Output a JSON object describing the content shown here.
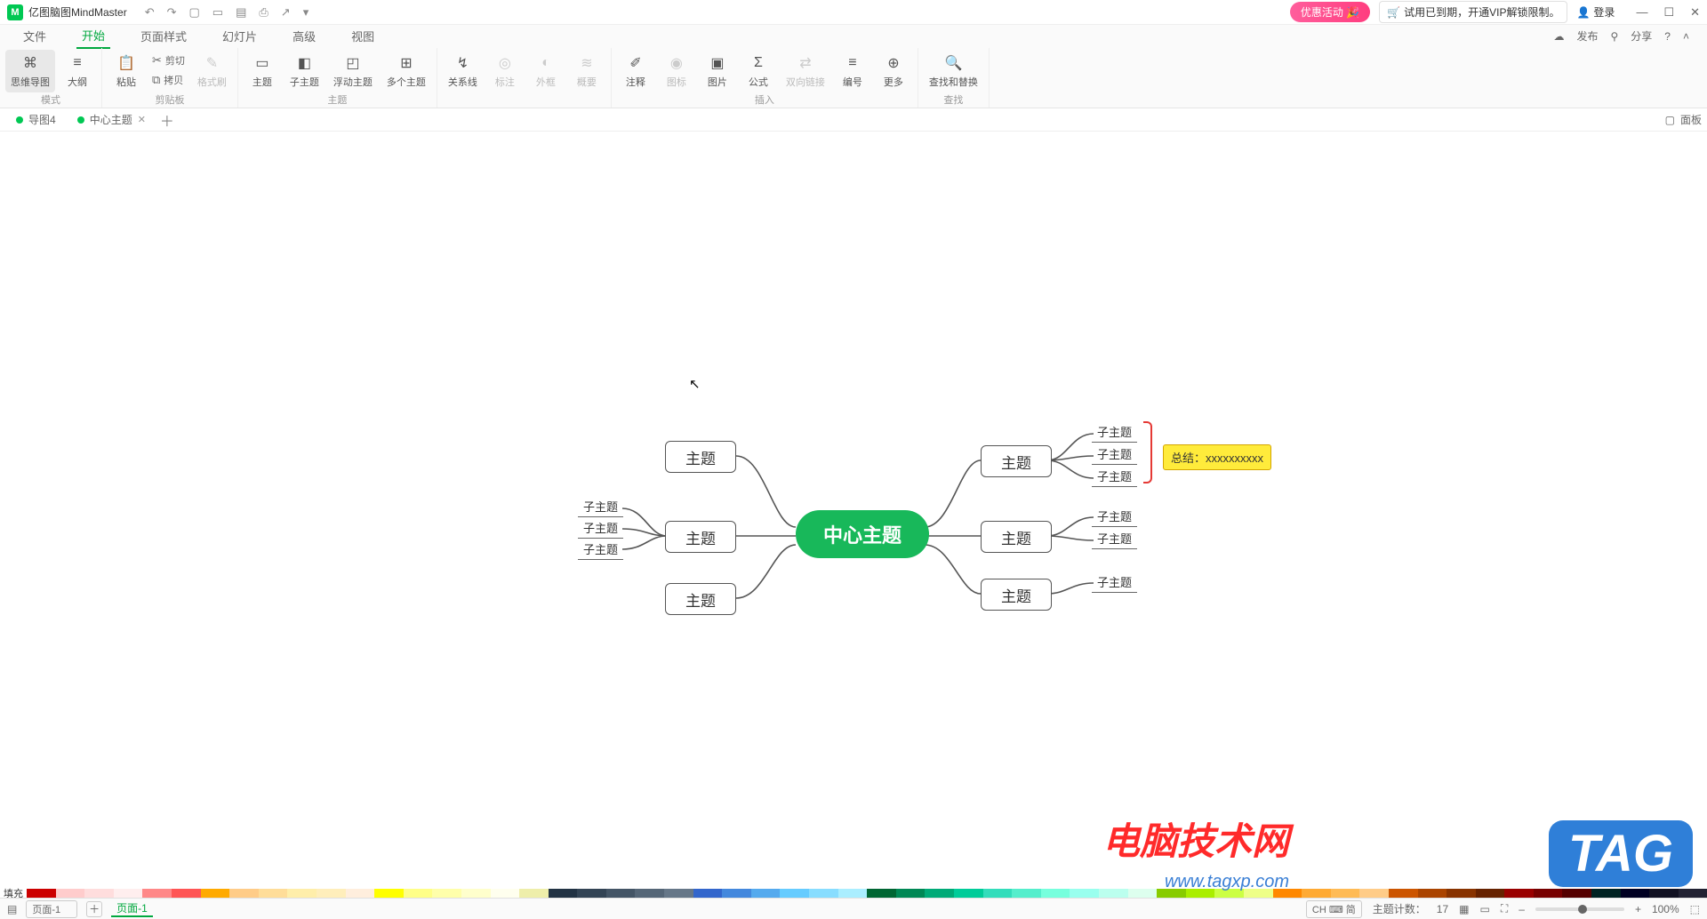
{
  "app": {
    "title": "亿图脑图MindMaster",
    "icon_letter": "M"
  },
  "qat": {
    "undo": "↶",
    "redo": "↷",
    "new": "▢",
    "open": "▭",
    "save": "▤",
    "print": "⎙",
    "export": "↗",
    "more": "▾"
  },
  "titlebar": {
    "promo": "优惠活动 🎉",
    "trial": "试用已到期，开通VIP解锁限制。",
    "login": "登录"
  },
  "menu": {
    "items": [
      "文件",
      "开始",
      "页面样式",
      "幻灯片",
      "高级",
      "视图"
    ],
    "active_index": 1,
    "publish": "发布",
    "share": "分享",
    "help": "?",
    "collapse": "˄"
  },
  "ribbon": {
    "groups": [
      {
        "label": "模式",
        "items": [
          {
            "icon": "⌘",
            "label": "思维导图",
            "big": true
          },
          {
            "icon": "≡",
            "label": "大纲",
            "big": true
          }
        ]
      },
      {
        "label": "剪贴板",
        "items": [
          {
            "icon": "📋",
            "label": "粘贴",
            "big": true
          },
          {
            "stack": [
              {
                "icon": "✂",
                "label": "剪切"
              },
              {
                "icon": "⧉",
                "label": "拷贝"
              }
            ]
          },
          {
            "icon": "✎",
            "label": "格式刷",
            "big": true,
            "disabled": true
          }
        ]
      },
      {
        "label": "主题",
        "items": [
          {
            "icon": "▭",
            "label": "主题",
            "big": true
          },
          {
            "icon": "◧",
            "label": "子主题",
            "big": true
          },
          {
            "icon": "◰",
            "label": "浮动主题",
            "big": true
          },
          {
            "icon": "⊞",
            "label": "多个主题",
            "big": true
          }
        ]
      },
      {
        "label": "",
        "items": [
          {
            "icon": "↯",
            "label": "关系线",
            "big": true
          },
          {
            "icon": "◎",
            "label": "标注",
            "big": true,
            "disabled": true
          },
          {
            "icon": "◐",
            "label": "外框",
            "big": true,
            "disabled": true
          },
          {
            "icon": "≋",
            "label": "概要",
            "big": true,
            "disabled": true
          }
        ]
      },
      {
        "label": "插入",
        "items": [
          {
            "icon": "✐",
            "label": "注释",
            "big": true
          },
          {
            "icon": "◉",
            "label": "图标",
            "big": true,
            "disabled": true
          },
          {
            "icon": "▣",
            "label": "图片",
            "big": true
          },
          {
            "icon": "Σ",
            "label": "公式",
            "big": true
          },
          {
            "icon": "⇄",
            "label": "双向链接",
            "big": true,
            "disabled": true
          },
          {
            "icon": "≡",
            "label": "编号",
            "big": true
          },
          {
            "icon": "⊕",
            "label": "更多",
            "big": true
          }
        ]
      },
      {
        "label": "查找",
        "items": [
          {
            "icon": "🔍",
            "label": "查找和替换",
            "big": true
          }
        ]
      }
    ]
  },
  "tabs": {
    "items": [
      {
        "label": "导图4",
        "active": false
      },
      {
        "label": "中心主题",
        "active": true
      }
    ],
    "panel": "面板"
  },
  "mindmap": {
    "center": "中心主题",
    "left_topics": [
      "主题",
      "主题",
      "主题"
    ],
    "right_topics": [
      "主题",
      "主题",
      "主题"
    ],
    "left_subs_mid": [
      "子主题",
      "子主题",
      "子主题"
    ],
    "right_subs_0": [
      "子主题",
      "子主题",
      "子主题"
    ],
    "right_subs_1": [
      "子主题",
      "子主题"
    ],
    "right_subs_2": [
      "子主题"
    ],
    "summary": "总结：xxxxxxxxxx"
  },
  "colorfill_label": "填充",
  "watermark": {
    "line1": "电脑技术网",
    "line2": "www.tagxp.com",
    "tag": "TAG"
  },
  "status": {
    "page_select": "页面-1",
    "page_tab": "页面-1",
    "ime": "CH ⌨ 简",
    "topic_count_label": "主题计数：",
    "topic_count": "17",
    "zoom": "100%"
  }
}
